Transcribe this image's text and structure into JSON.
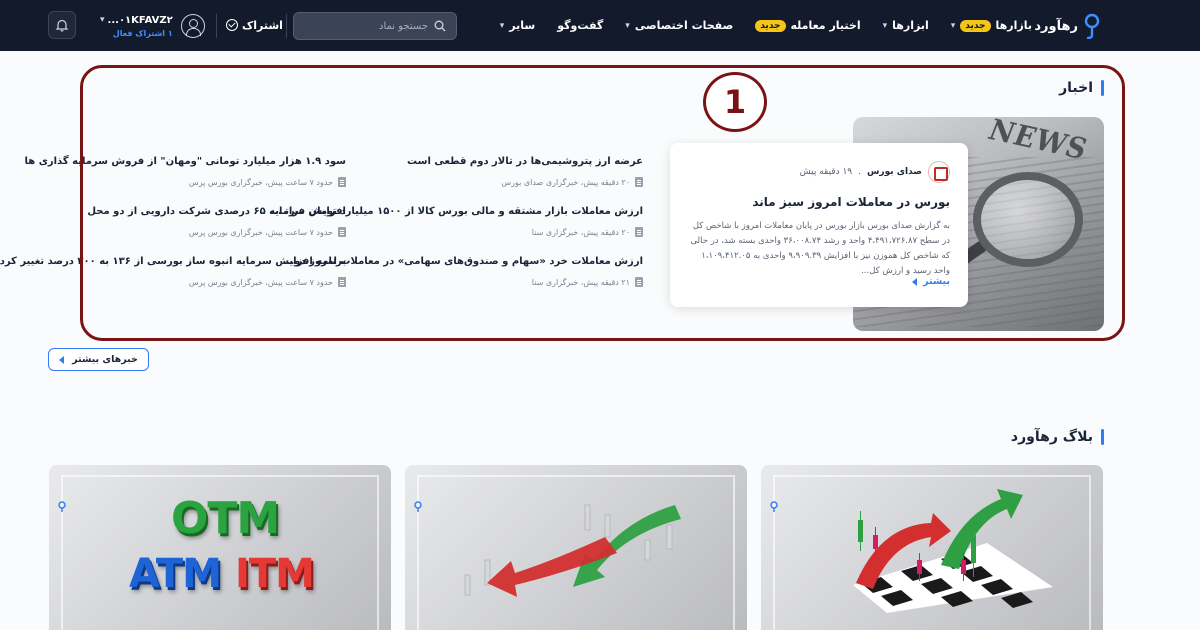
{
  "header": {
    "logo_text": "رهآورد",
    "nav": [
      {
        "label": "بازارها",
        "badge": "جدید"
      },
      {
        "label": "ابزارها"
      },
      {
        "label": "اختیار معامله",
        "badge": "جدید"
      },
      {
        "label": "صفحات اختصاصی"
      },
      {
        "label": "گفت‌وگو"
      },
      {
        "label": "سایر"
      }
    ],
    "search_placeholder": "جستجو نماد",
    "subscribe_label": "اشتراک",
    "user_name": "۰۱KFAVZ۲...",
    "user_subscription": "۱ اشتراک فعال"
  },
  "news": {
    "section_title": "اخبار",
    "annotation_marker": "1",
    "featured": {
      "source": "صدای بورس",
      "time": "۱۹ دقیقه پیش",
      "title": "بورس در معاملات امروز سبز ماند",
      "body": "به گزارش صدای بورس بازار بورس در پایان معاملات امروز با شاخص کل در سطح ۴،۴۹۱،۷۲۶.۸۷ واحد و رشد ۳۶،۰۰۸.۷۴ واحدی بسته شد، در حالی که شاخص کل هموزن نیز با افزایش ۹،۹۰۹.۳۹ واحدی به ۱،۱۰۹،۴۱۲.۰۵ واحد رسید و ارزش کل...",
      "more_label": "بیشتر"
    },
    "items_col1": [
      {
        "title": "عرضه ارز پتروشیمی‌ها در تالار دوم قطعی است",
        "meta": "۲۰ دقیقه پیش، خبرگزاری صدای بورس"
      },
      {
        "title": "ارزش معاملات بازار مشتقه و مالی بورس کالا از ۱۵۰۰ میلیارد تومان فراتـ...",
        "meta": "۲۰ دقیقه پیش، خبرگزاری سنا"
      },
      {
        "title": "ارزش معاملات خرد «سهام و صندوق‌های سهامی» در معاملات امروز دو...",
        "meta": "۲۱ دقیقه پیش، خبرگزاری سنا"
      }
    ],
    "items_col2": [
      {
        "title": "سود ۱.۹ هزار میلیارد تومانی \"ومهان\" از فروش سرمایه گذاری ها",
        "meta": "حدود ۷ ساعت پیش، خبرگزاری بورس پرس"
      },
      {
        "title": "افزایش سرمایه ۶۵ درصدی شرکت دارویی از دو محل",
        "meta": "حدود ۷ ساعت پیش، خبرگزاری بورس پرس"
      },
      {
        "title": "برنامه افزایش سرمایه انبوه ساز بورسی از ۱۳۶ به ۲۰۰ درصد تغییر کرد",
        "meta": "حدود ۷ ساعت پیش، خبرگزاری بورس پرس"
      }
    ],
    "more_news_label": "خبرهای بیشتر"
  },
  "blog": {
    "section_title": "بلاگ رهآورد",
    "card3": {
      "line1": "OTM",
      "line2a": "ATM",
      "line2b": "ITM"
    }
  },
  "colors": {
    "topbar": "#121a2c",
    "accent": "#2f7cf6",
    "badge": "#f5c518",
    "annotation": "#7a1414"
  }
}
